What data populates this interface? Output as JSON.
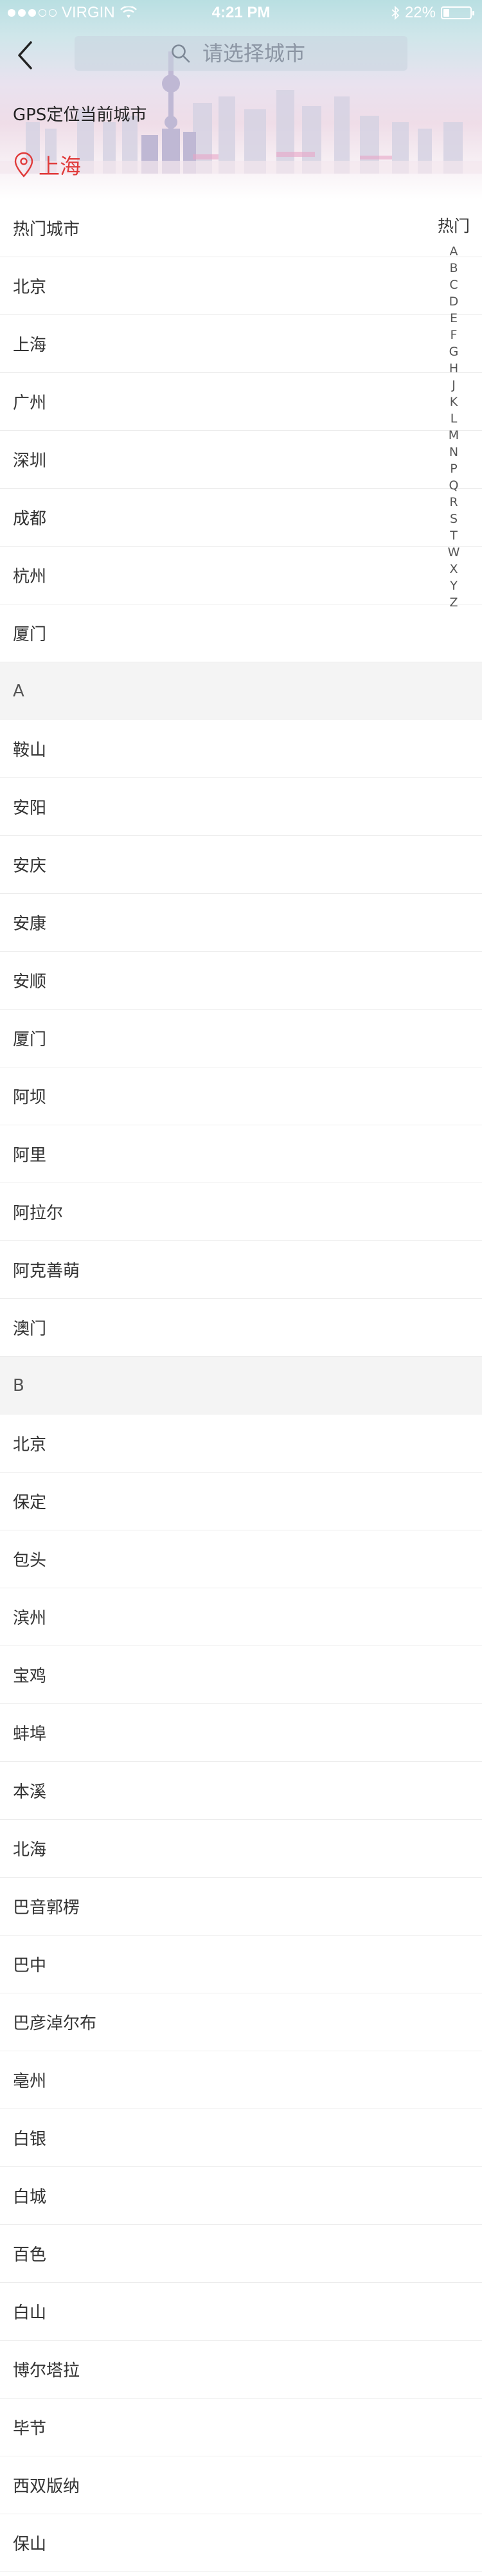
{
  "status_bar": {
    "carrier": "VIRGIN",
    "time": "4:21 PM",
    "battery": "22%",
    "battery_level": 0.22
  },
  "header": {
    "back_icon": "chevron-left-icon",
    "search_placeholder": "请选择城市",
    "search_icon": "search-icon",
    "gps_label": "GPS定位当前城市",
    "current_city": "上海",
    "location_icon": "location-pin-icon",
    "accent_color": "#e03a3a"
  },
  "hot": {
    "title": "热门城市",
    "cities": [
      "北京",
      "上海",
      "广州",
      "深圳",
      "成都",
      "杭州",
      "厦门"
    ]
  },
  "sections": [
    {
      "letter": "A",
      "cities": [
        "鞍山",
        "安阳",
        "安庆",
        "安康",
        "安顺",
        "厦门",
        "阿坝",
        "阿里",
        "阿拉尔",
        "阿克善萌",
        "澳门"
      ]
    },
    {
      "letter": "B",
      "cities": [
        "北京",
        "保定",
        "包头",
        "滨州",
        "宝鸡",
        "蚌埠",
        "本溪",
        "北海",
        "巴音郭楞",
        "巴中",
        "巴彦淖尔布",
        "亳州",
        "白银",
        "白城",
        "百色",
        "白山",
        "博尔塔拉",
        "毕节",
        "西双版纳",
        "保山"
      ]
    }
  ],
  "index_bar": {
    "hot_label": "热门",
    "letters": [
      "A",
      "B",
      "C",
      "D",
      "E",
      "F",
      "G",
      "H",
      "J",
      "K",
      "L",
      "M",
      "N",
      "P",
      "Q",
      "R",
      "S",
      "T",
      "W",
      "X",
      "Y",
      "Z"
    ]
  }
}
